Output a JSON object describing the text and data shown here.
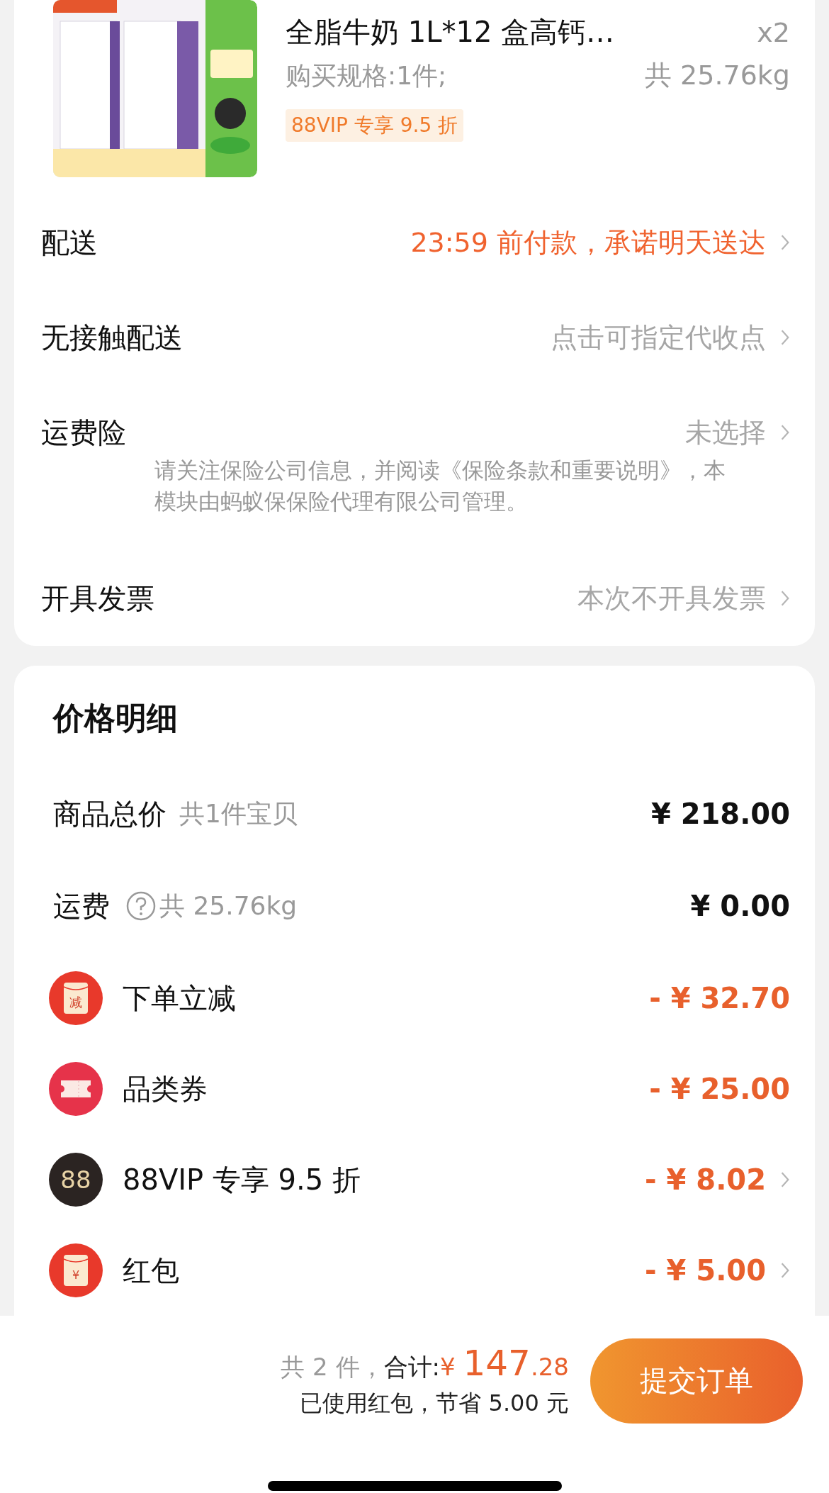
{
  "product": {
    "title": "全脂牛奶 1L*12 盒高钙…",
    "quantity": "x2",
    "spec": "购买规格:1件;",
    "weight": "共 25.76kg",
    "tag": "88VIP 专享 9.5 折"
  },
  "order_rows": [
    {
      "label": "配送",
      "value": "23:59 前付款，承诺明天送达",
      "highlight": true
    },
    {
      "label": "无接触配送",
      "value": "点击可指定代收点",
      "highlight": false
    },
    {
      "label": "运费险",
      "value": "未选择",
      "highlight": false,
      "note": "请关注保险公司信息，并阅读《保险条款和重要说明》，本模块由蚂蚁保保险代理有限公司管理。"
    },
    {
      "label": "开具发票",
      "value": "本次不开具发票",
      "highlight": false
    }
  ],
  "price_detail": {
    "title": "价格明细",
    "rows": [
      {
        "kind": "plain",
        "label": "商品总价",
        "sub": "共1件宝贝",
        "value": "¥ 218.00",
        "help": false
      },
      {
        "kind": "plain",
        "label": "运费",
        "sub": "共 25.76kg",
        "value": "¥ 0.00",
        "help": true
      }
    ],
    "discounts": [
      {
        "kind": "reduce",
        "icon_text": "减",
        "label": "下单立减",
        "value": "- ¥ 32.70",
        "chevron": false
      },
      {
        "kind": "coupon",
        "label": "品类券",
        "value": "- ¥ 25.00",
        "chevron": false
      },
      {
        "kind": "vip",
        "icon_text": "88",
        "label": "88VIP 专享 9.5 折",
        "value": "- ¥ 8.02",
        "chevron": true
      },
      {
        "kind": "redpacket",
        "icon_text": "¥",
        "label": "红包",
        "value": "- ¥ 5.00",
        "chevron": true
      }
    ]
  },
  "footer": {
    "count": "共 2 件，",
    "total_label": "合计:",
    "currency": "¥",
    "total_int": "147",
    "total_dec": ".28",
    "saving": "已使用红包，节省 5.00 元",
    "submit": "提交订单"
  }
}
